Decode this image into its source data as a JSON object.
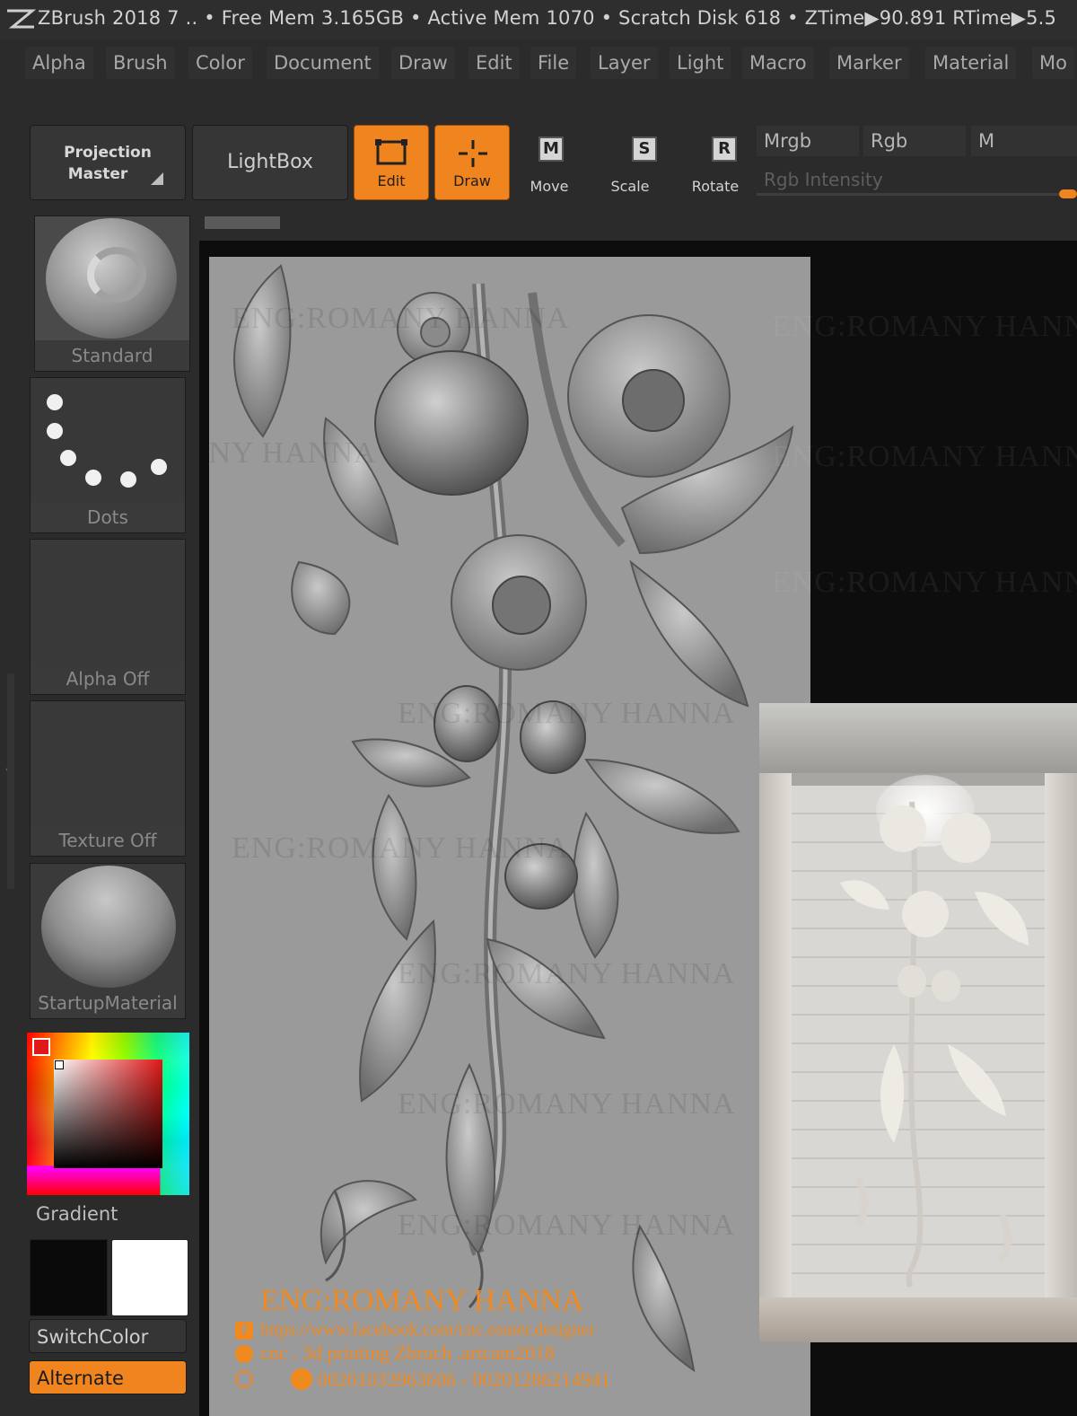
{
  "titlebar": {
    "text": "ZBrush 2018   7   .. • Free Mem 3.165GB • Active Mem 1070 • Scratch Disk 618 •  ZTime▶90.891 RTime▶5.5"
  },
  "menu": [
    "Alpha",
    "Brush",
    "Color",
    "Document",
    "Draw",
    "Edit",
    "File",
    "Layer",
    "Light",
    "Macro",
    "Marker",
    "Material",
    "Mo"
  ],
  "toolbar": {
    "projection_master": [
      "Projection",
      "Master"
    ],
    "lightbox": "LightBox",
    "edit": "Edit",
    "draw": "Draw",
    "move": "Move",
    "scale": "Scale",
    "rotate": "Rotate",
    "move_key": "M",
    "scale_key": "S",
    "rotate_key": "R",
    "mrgb": "Mrgb",
    "rgb": "Rgb",
    "m": "M",
    "rgb_intensity": "Rgb Intensity"
  },
  "left_panel": {
    "brush": "Standard",
    "stroke": "Dots",
    "alpha": "Alpha Off",
    "texture": "Texture Off",
    "material": "StartupMaterial",
    "gradient": "Gradient",
    "switch_color": "SwitchColor",
    "alternate": "Alternate"
  },
  "watermark": "ENG:ROMANY HANNA",
  "credits": {
    "name": "ENG:ROMANY HANNA",
    "facebook": "https://www.facebook.com/cnc.router.designer",
    "tagline": "cnc . 3d printing Zbruch .artcam2018",
    "phones": "00201033963606 - 00201286214941"
  },
  "colors": {
    "accent": "#f0841e",
    "panel": "#2b2b2b",
    "canvas": "#9a9a9a",
    "credits": "#f08a20"
  }
}
